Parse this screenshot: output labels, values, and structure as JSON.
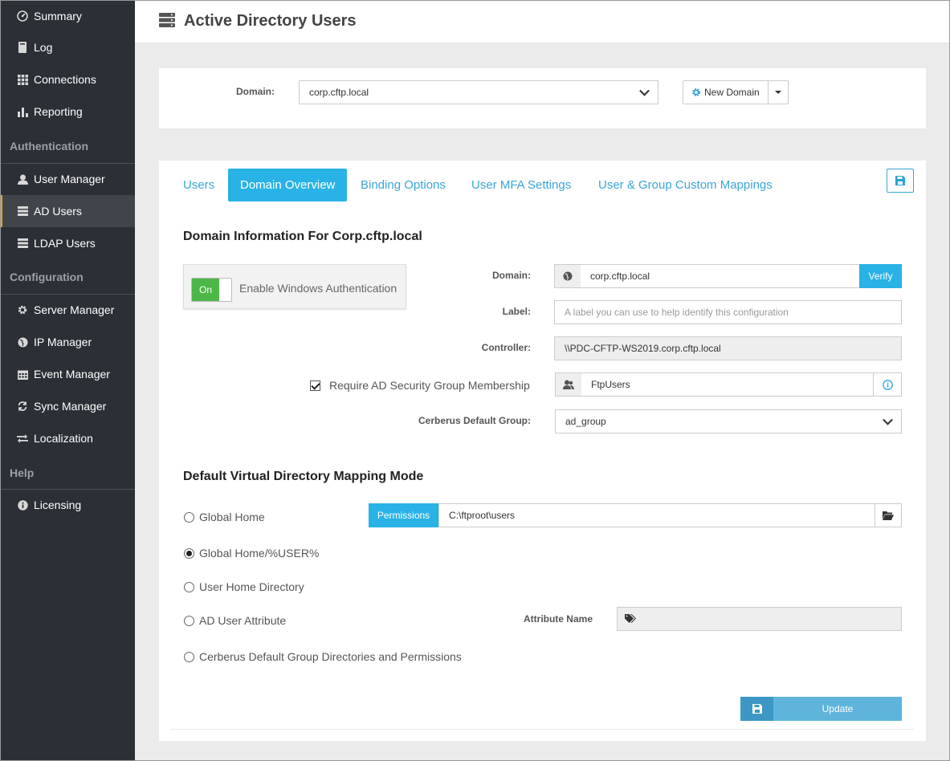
{
  "sidebar": {
    "items_top": [
      {
        "label": "Summary",
        "icon": "dashboard-icon"
      },
      {
        "label": "Log",
        "icon": "book-icon"
      },
      {
        "label": "Connections",
        "icon": "grid-icon"
      },
      {
        "label": "Reporting",
        "icon": "bar-chart-icon"
      }
    ],
    "sections": {
      "authentication": "Authentication",
      "configuration": "Configuration",
      "help": "Help"
    },
    "items_auth": [
      {
        "label": "User Manager",
        "icon": "user-icon"
      },
      {
        "label": "AD Users",
        "icon": "server-icon",
        "active": true
      },
      {
        "label": "LDAP Users",
        "icon": "server-icon"
      }
    ],
    "items_config": [
      {
        "label": "Server Manager",
        "icon": "gear-icon"
      },
      {
        "label": "IP Manager",
        "icon": "globe-icon"
      },
      {
        "label": "Event Manager",
        "icon": "calendar-icon"
      },
      {
        "label": "Sync Manager",
        "icon": "refresh-icon"
      },
      {
        "label": "Localization",
        "icon": "exchange-icon"
      }
    ],
    "items_help": [
      {
        "label": "Licensing",
        "icon": "info-icon"
      }
    ],
    "accent_color": "#e7a224"
  },
  "header": {
    "title": "Active Directory Users"
  },
  "domain_bar": {
    "label": "Domain:",
    "selected": "corp.cftp.local",
    "new_domain": "New Domain"
  },
  "tabs": [
    "Users",
    "Domain Overview",
    "Binding Options",
    "User MFA Settings",
    "User & Group Custom Mappings"
  ],
  "active_tab": "Domain Overview",
  "domain_info": {
    "title": "Domain Information For Corp.cftp.local",
    "toggle_state": "On",
    "toggle_label": "Enable Windows Authentication",
    "domain_label": "Domain:",
    "domain_value": "corp.cftp.local",
    "verify": "Verify",
    "label_label": "Label:",
    "label_placeholder": "A label you can use to help identify this configuration",
    "controller_label": "Controller:",
    "controller_value": "\\\\PDC-CFTP-WS2019.corp.cftp.local",
    "require_group_label": "Require AD Security Group Membership",
    "require_group_checked": true,
    "group_value": "FtpUsers",
    "default_group_label": "Cerberus Default Group:",
    "default_group_value": "ad_group"
  },
  "mapping": {
    "title": "Default Virtual Directory Mapping Mode",
    "options": [
      "Global Home",
      "Global Home/%USER%",
      "User Home Directory",
      "AD User Attribute",
      "Cerberus Default Group Directories and Permissions"
    ],
    "selected_index": 1,
    "permissions_btn": "Permissions",
    "path_value": "C:\\ftproot\\users",
    "attribute_label": "Attribute Name",
    "attribute_value": ""
  },
  "update_label": "Update",
  "colors": {
    "sidebar_bg": "#2b3036",
    "primary": "#29b2e5",
    "toggle_on": "#4cb748"
  }
}
